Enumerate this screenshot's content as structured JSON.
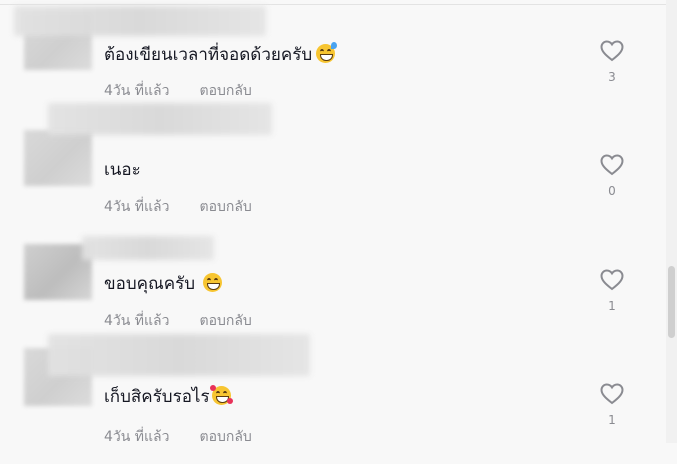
{
  "comments": [
    {
      "text": "ต้องเขียนเวลาที่จอดด้วยครับ",
      "emoji": "grinning-sweat",
      "time": "4วัน ที่แล้ว",
      "reply": "ตอบกลับ",
      "likes": "3"
    },
    {
      "text": "เนอะ",
      "emoji": "",
      "time": "4วัน ที่แล้ว",
      "reply": "ตอบกลับ",
      "likes": "0"
    },
    {
      "text": "ขอบคุณครับ",
      "emoji": "beaming-grin",
      "time": "4วัน ที่แล้ว",
      "reply": "ตอบกลับ",
      "likes": "1"
    },
    {
      "text": "เก็บสิครับรอไร",
      "emoji": "smiling-with-hearts",
      "time": "4วัน ที่แล้ว",
      "reply": "ตอบกลับ",
      "likes": "1"
    }
  ]
}
